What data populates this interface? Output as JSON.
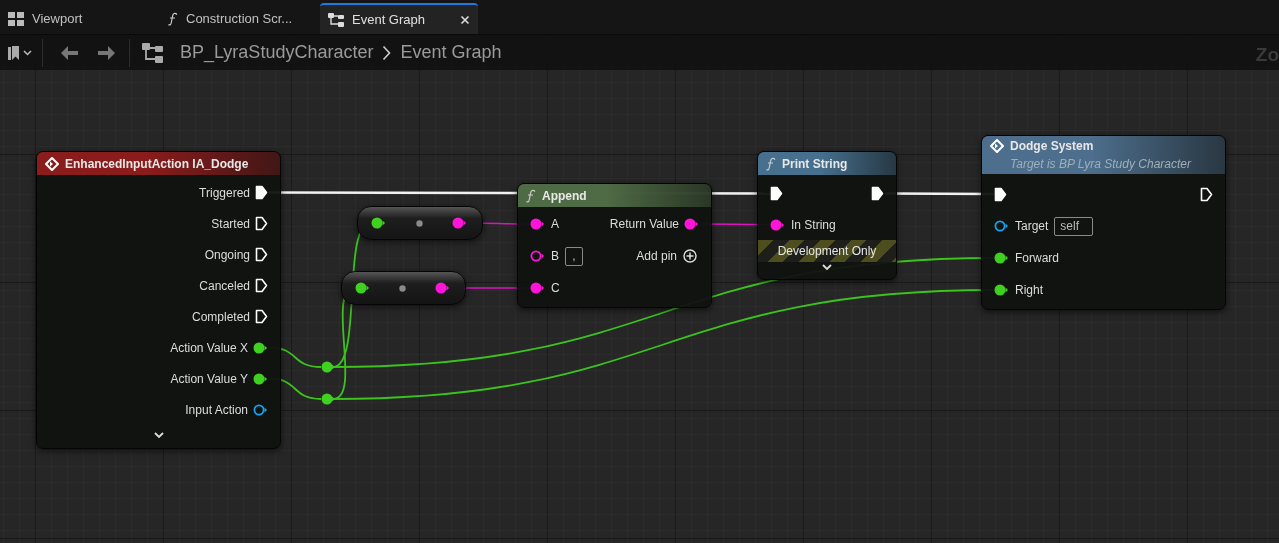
{
  "tabs": [
    {
      "label": "Viewport",
      "selected": false
    },
    {
      "label": "Construction Scr...",
      "selected": false
    },
    {
      "label": "Event Graph",
      "selected": true
    }
  ],
  "toolbar": {
    "breadcrumb": [
      "BP_LyraStudyCharacter",
      "Event Graph"
    ]
  },
  "zoom_label": "Zo",
  "nodes": [
    {
      "kind": "event",
      "title": "EnhancedInputAction IA_Dodge",
      "color": "#8a1c1c",
      "advanced": true,
      "outputs": [
        {
          "kind": "exec",
          "label": "Triggered",
          "connected": true
        },
        {
          "kind": "exec",
          "label": "Started",
          "connected": false
        },
        {
          "kind": "exec",
          "label": "Ongoing",
          "connected": false
        },
        {
          "kind": "exec",
          "label": "Canceled",
          "connected": false
        },
        {
          "kind": "exec",
          "label": "Completed",
          "connected": false
        },
        {
          "kind": "float",
          "label": "Action Value X",
          "connected": true
        },
        {
          "kind": "float",
          "label": "Action Value Y",
          "connected": true
        },
        {
          "kind": "object",
          "label": "Input Action",
          "connected": false
        }
      ]
    },
    {
      "kind": "compact",
      "inputs": [
        {
          "kind": "float",
          "connected": true
        }
      ],
      "outputs": [
        {
          "kind": "string",
          "connected": true
        }
      ]
    },
    {
      "kind": "compact",
      "inputs": [
        {
          "kind": "float",
          "connected": true
        }
      ],
      "outputs": [
        {
          "kind": "string",
          "connected": true
        }
      ]
    },
    {
      "kind": "function",
      "title": "Append",
      "color": "#4f6b45",
      "inputs": [
        {
          "kind": "string",
          "label": "A",
          "connected": true
        },
        {
          "kind": "string",
          "label": "B",
          "connected": false,
          "value": ","
        },
        {
          "kind": "string",
          "label": "C",
          "connected": true
        }
      ],
      "outputs": [
        {
          "kind": "string",
          "label": "Return Value",
          "connected": true
        },
        {
          "kind": "add",
          "label": "Add pin"
        }
      ]
    },
    {
      "kind": "function",
      "title": "Print String",
      "color": "#46708e",
      "advanced": true,
      "dev_only": "Development Only",
      "inputs": [
        {
          "kind": "exec",
          "connected": true
        },
        {
          "kind": "string",
          "label": "In String",
          "connected": true
        }
      ],
      "outputs": [
        {
          "kind": "exec",
          "connected": true
        }
      ]
    },
    {
      "kind": "custom_call",
      "title": "Dodge System",
      "subtitle": "Target is BP Lyra Study Character",
      "color": "#4d6e8c",
      "inputs": [
        {
          "kind": "exec",
          "connected": true
        },
        {
          "kind": "object",
          "label": "Target",
          "connected": false,
          "value": "self"
        },
        {
          "kind": "float",
          "label": "Forward",
          "connected": true
        },
        {
          "kind": "float",
          "label": "Right",
          "connected": true
        }
      ],
      "outputs": [
        {
          "kind": "exec",
          "connected": false
        }
      ]
    }
  ]
}
